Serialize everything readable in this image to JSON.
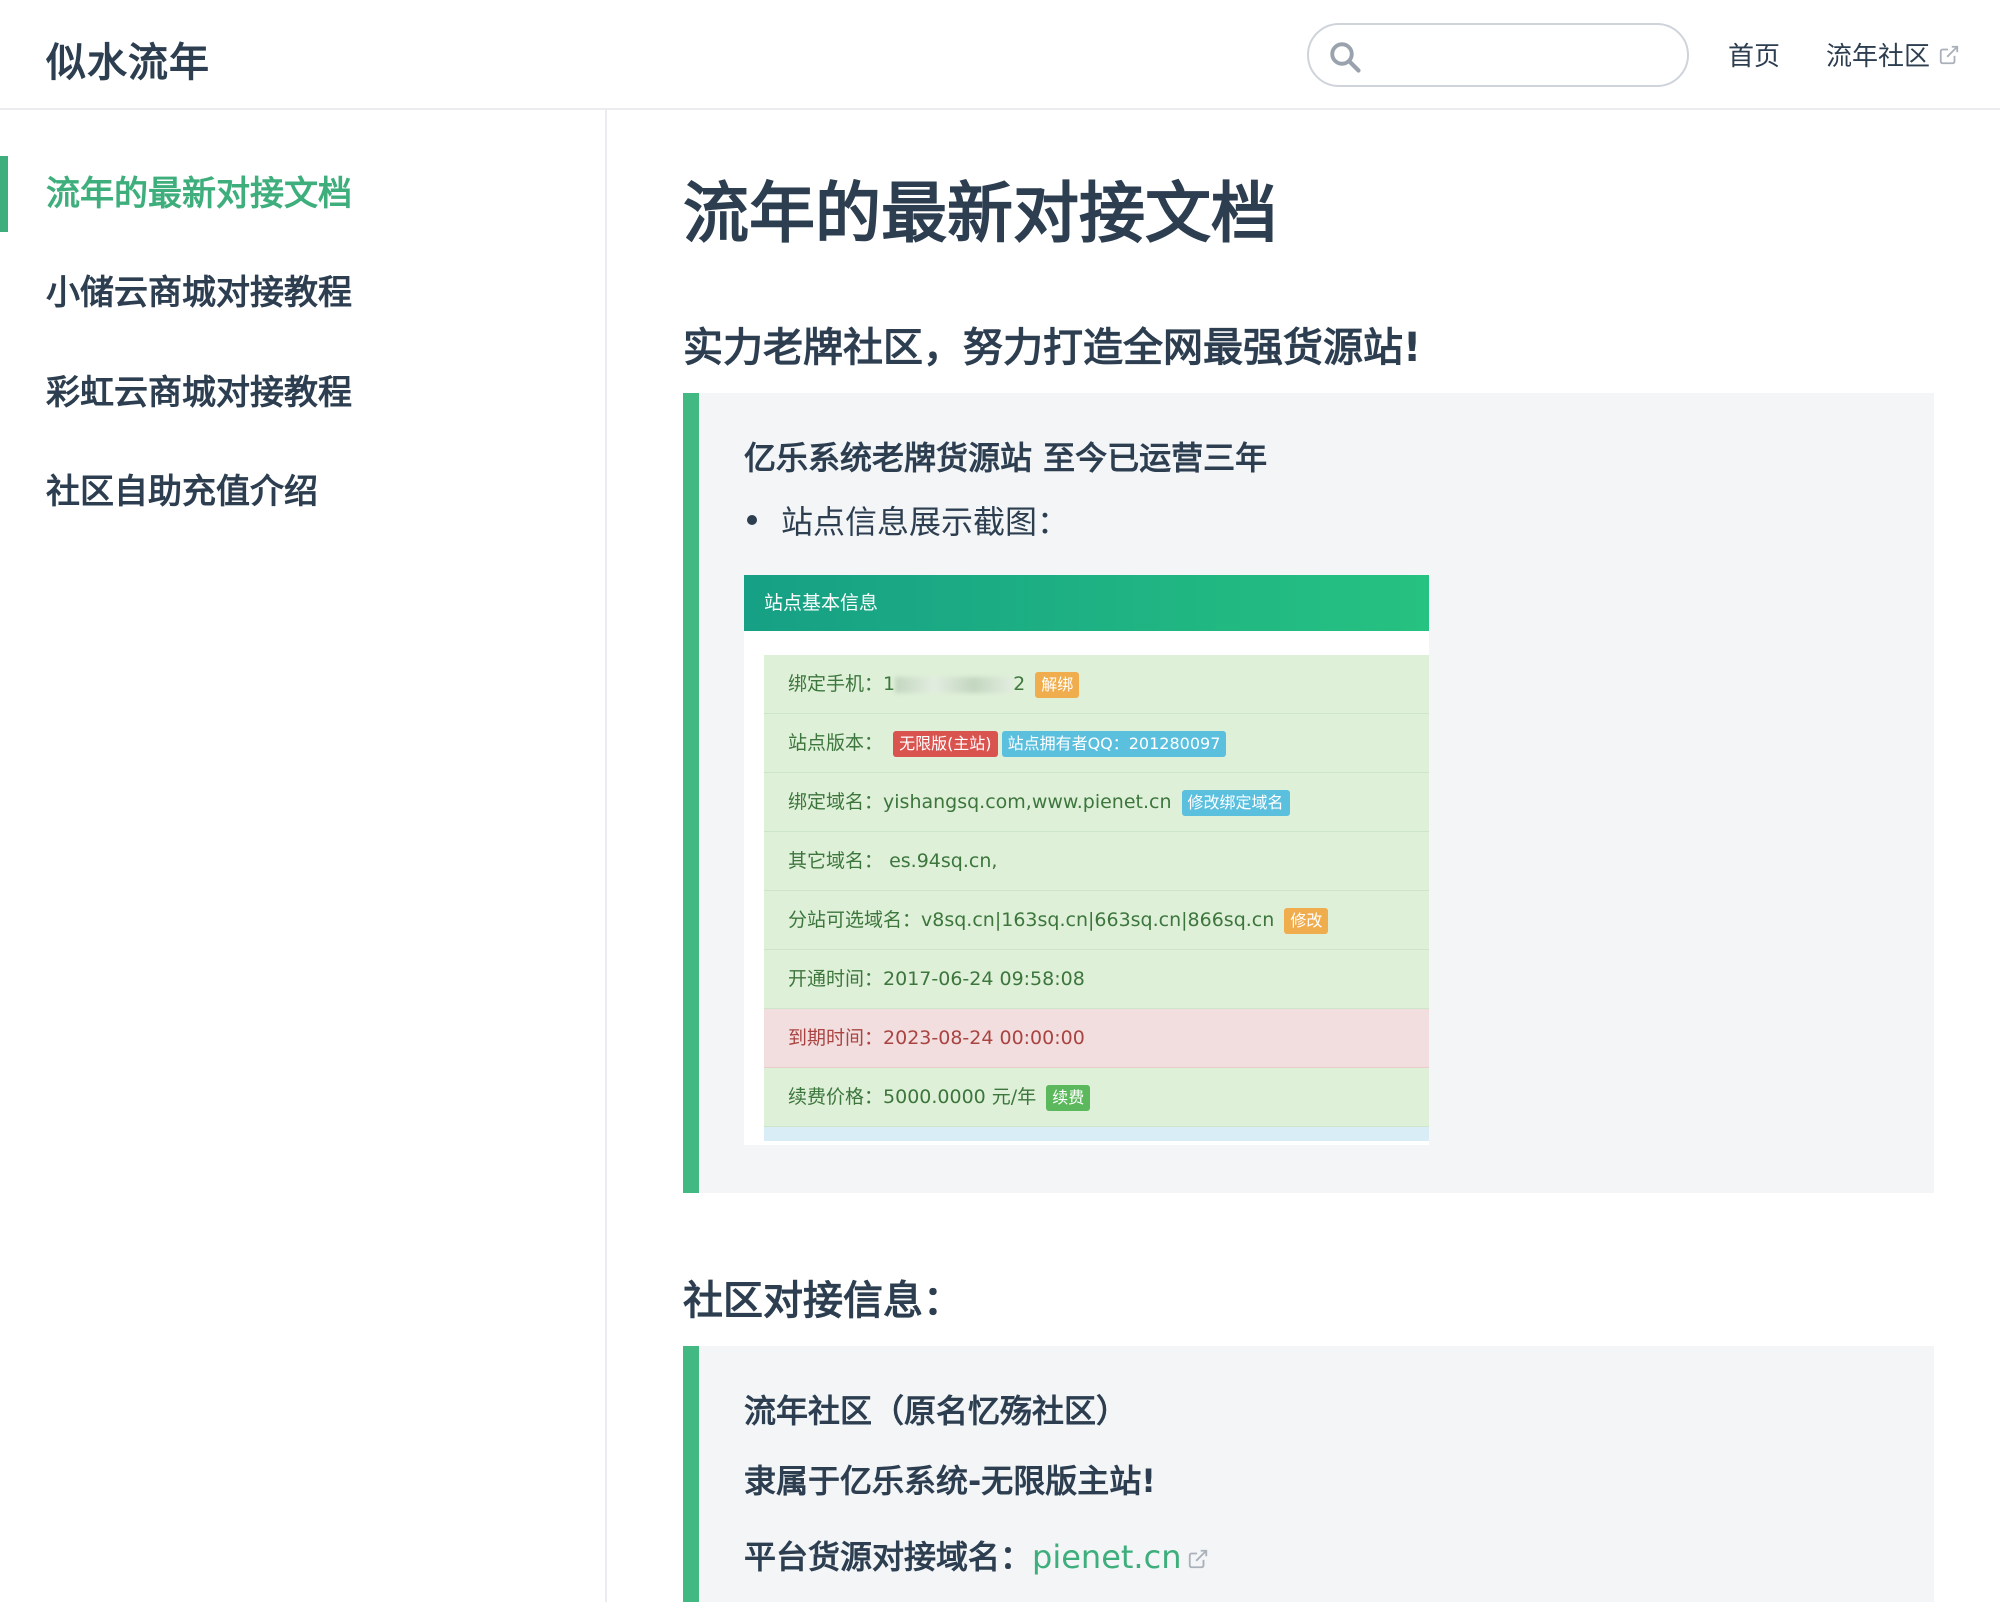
{
  "navbar": {
    "site_name": "似水流年",
    "search_placeholder": "",
    "links": [
      {
        "label": "首页"
      },
      {
        "label": "流年社区"
      }
    ]
  },
  "sidebar": {
    "items": [
      {
        "label": "流年的最新对接文档",
        "active": true
      },
      {
        "label": "小储云商城对接教程"
      },
      {
        "label": "彩虹云商城对接教程"
      },
      {
        "label": "社区自助充值介绍"
      }
    ]
  },
  "main": {
    "title": "流年的最新对接文档",
    "section1": {
      "heading": "实力老牌社区，努力打造全网最强货源站!",
      "tip_title": "亿乐系统老牌货源站 至今已运营三年",
      "bullet": "站点信息展示截图：",
      "panel": {
        "header": "站点基本信息",
        "rows": [
          {
            "label": "绑定手机：",
            "pre": "1",
            "post": "2",
            "badge": "解绑"
          },
          {
            "label": "站点版本：",
            "badge1": "无限版(主站)",
            "badge2": "站点拥有者QQ：201280097"
          },
          {
            "label": "绑定域名：",
            "value": "yishangsq.com,www.pienet.cn",
            "badge": "修改绑定域名"
          },
          {
            "label": "其它域名：",
            "value": "es.94sq.cn,"
          },
          {
            "label": "分站可选域名：",
            "value": "v8sq.cn|163sq.cn|663sq.cn|866sq.cn",
            "badge": "修改"
          },
          {
            "label": "开通时间：",
            "value": "2017-06-24 09:58:08"
          },
          {
            "label": "到期时间：",
            "value": "2023-08-24 00:00:00"
          },
          {
            "label": "续费价格：",
            "value": "5000.0000 元/年",
            "badge": "续费"
          }
        ]
      }
    },
    "section2": {
      "heading": "社区对接信息：",
      "line1": "流年社区（原名忆殇社区）",
      "line2": "隶属于亿乐系统-无限版主站!",
      "line3_label": "平台货源对接域名：",
      "line3_link": "pienet.cn"
    }
  },
  "colors": {
    "accent": "#3eaf7c",
    "text": "#2c3e50",
    "tip_bg": "#f3f5f7",
    "tip_border": "#42b983"
  }
}
